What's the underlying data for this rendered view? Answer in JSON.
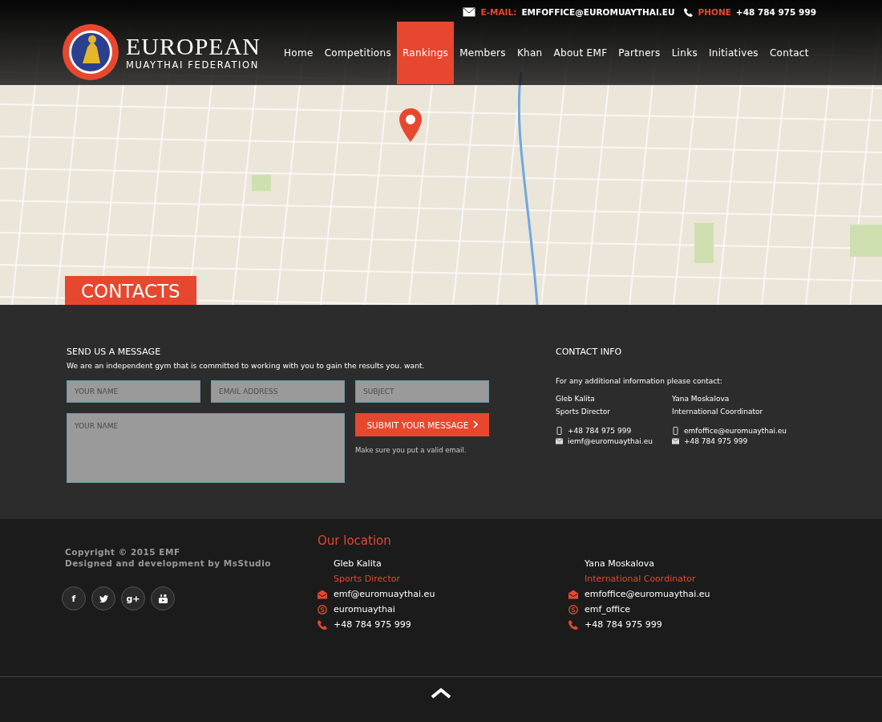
{
  "topbar": {
    "email_label": "E-MAIL:",
    "email": "EMFOFFICE@EUROMUAYTHAI.EU",
    "phone_label": "PHONE",
    "phone": "+48 784 975 999"
  },
  "logo": {
    "title": "EUROPEAN",
    "subtitle": "MUAYTHAI FEDERATION"
  },
  "nav": [
    {
      "label": "Home",
      "selected": false
    },
    {
      "label": "Competitions",
      "selected": false
    },
    {
      "label": "Rankings",
      "selected": true
    },
    {
      "label": "Members",
      "selected": false
    },
    {
      "label": "Khan",
      "selected": false
    },
    {
      "label": "About EMF",
      "selected": false
    },
    {
      "label": "Partners",
      "selected": false
    },
    {
      "label": "Links",
      "selected": false
    },
    {
      "label": "Initiatives",
      "selected": false
    },
    {
      "label": "Contact",
      "selected": false
    }
  ],
  "page_title": "CONTACTS",
  "message_form": {
    "title": "SEND US A MESSAGE",
    "intro": "We are an independent gym that is committed to working with you to gain the results you. want.",
    "fields": [
      {
        "placeholder": "YOUR NAME"
      },
      {
        "placeholder": "EMAIL ADDRESS"
      },
      {
        "placeholder": "SUBJECT"
      }
    ],
    "message": {
      "placeholder": "YOUR NAME"
    },
    "submit": "SUBMIT YOUR MESSAGE",
    "note": "Make sure you put a valid email."
  },
  "contact_info": {
    "title": "CONTACT INFO",
    "intro": "For any additional information please contact:",
    "people": [
      {
        "name": "Gleb Kalita",
        "role": "Sports Director",
        "lines": [
          {
            "kind": "phone",
            "text": "+48 784 975 999"
          },
          {
            "kind": "email",
            "text": "iemf@euromuaythai.eu"
          }
        ]
      },
      {
        "name": "Yana Moskalova",
        "role": "International Coordinator",
        "lines": [
          {
            "kind": "phone",
            "text": "emfoffice@euromuaythai.eu"
          },
          {
            "kind": "email",
            "text": "+48 784 975 999"
          }
        ]
      }
    ]
  },
  "footer": {
    "copyright": "Copyright © 2015 EMF",
    "credits": "Designed and development by MsStudio",
    "social": [
      {
        "kind": "facebook",
        "glyph": "f"
      },
      {
        "kind": "twitter"
      },
      {
        "kind": "googleplus",
        "glyph": "g+"
      },
      {
        "kind": "youtube"
      }
    ],
    "location_title": "Our location",
    "people": [
      {
        "name": "Gleb Kalita",
        "role": "Sports Director",
        "lines": [
          {
            "kind": "email",
            "text": "emf@euromuaythai.eu"
          },
          {
            "kind": "skype",
            "text": "euromuaythai"
          },
          {
            "kind": "phone",
            "text": "+48 784 975 999"
          }
        ]
      },
      {
        "name": "Yana Moskalova",
        "role": "International Coordinator",
        "lines": [
          {
            "kind": "email",
            "text": "emfoffice@euromuaythai.eu"
          },
          {
            "kind": "skype",
            "text": "emf_office"
          },
          {
            "kind": "phone",
            "text": "+48 784 975 999"
          }
        ]
      }
    ]
  }
}
